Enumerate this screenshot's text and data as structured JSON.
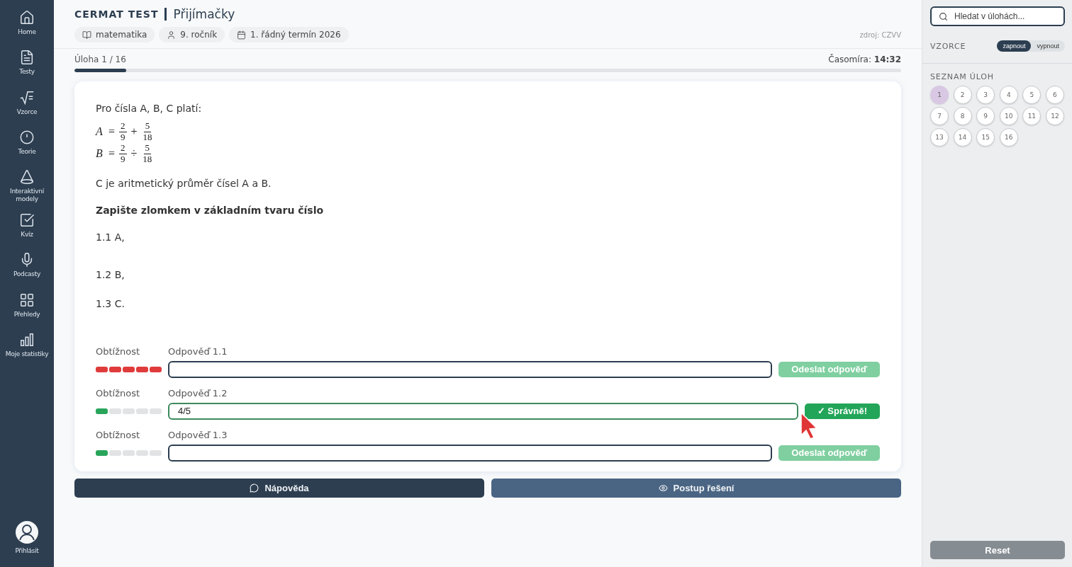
{
  "nav": [
    {
      "label": "Home"
    },
    {
      "label": "Testy"
    },
    {
      "label": "Vzorce"
    },
    {
      "label": "Teorie"
    },
    {
      "label": "Interaktivní modely"
    },
    {
      "label": "Kvíz"
    },
    {
      "label": "Podcasty"
    },
    {
      "label": "Přehledy"
    },
    {
      "label": "Moje statistiky"
    }
  ],
  "account": {
    "label": "Přihlásit"
  },
  "header": {
    "brand": "CERMAT TEST",
    "title": "Přijímačky",
    "chips": [
      {
        "kind": "subject",
        "label": "matematika"
      },
      {
        "kind": "grade",
        "label": "9. ročník"
      },
      {
        "kind": "term",
        "label": "1. řádný termín 2026"
      }
    ],
    "source": "zdroj: CZVV"
  },
  "progress": {
    "label": "Úloha 1 / 16",
    "level": 0.0625,
    "timer_label": "Časomíra:",
    "timer_value": "14:32"
  },
  "task": {
    "intro": "Pro čísla A, B, C platí:",
    "formulas": [
      {
        "variable": "A",
        "relation": "=",
        "left": {
          "num": "2",
          "den": "9"
        },
        "operator": "+",
        "right": {
          "num": "5",
          "den": "18"
        }
      },
      {
        "variable": "B",
        "relation": "=",
        "left": {
          "num": "2",
          "den": "9"
        },
        "operator": "÷",
        "right": {
          "num": "5",
          "den": "18"
        }
      }
    ],
    "statement": "C je aritmetický průměr čísel A a B.",
    "instruction": "Zapište zlomkem v základním tvaru číslo",
    "parts": [
      "1.1 A,",
      "1.2 B,",
      "1.3 C."
    ]
  },
  "answers": [
    {
      "difficulty_label": "Obtížnost",
      "stars": 5,
      "color": "#e03b3b",
      "label": "Odpověď 1.1",
      "correct": false,
      "button": "Odeslat odpověď"
    },
    {
      "difficulty_label": "Obtížnost",
      "stars": 1,
      "color": "#28a55b",
      "label": "Odpověď 1.2",
      "value": "4/5",
      "correct": true,
      "button": "✓ Správně!"
    },
    {
      "difficulty_label": "Obtížnost",
      "stars": 1,
      "color": "#28a55b",
      "label": "Odpověď 1.3",
      "correct": false,
      "button": "Odeslat odpověď"
    }
  ],
  "actions": [
    {
      "kind": "hint",
      "label": "Nápověda"
    },
    {
      "kind": "solution",
      "label": "Postup řešení"
    }
  ],
  "panel": {
    "search": {
      "placeholder": "Hledat v úlohách..."
    },
    "formulas": {
      "title": "VZORCE",
      "options": [
        {
          "label": "zapnout",
          "selected": true
        },
        {
          "label": "vypnout",
          "selected": false
        }
      ]
    },
    "task_list": {
      "title": "SEZNAM ÚLOH",
      "items": [
        {
          "label": "1",
          "selected": true
        },
        {
          "label": "2",
          "selected": false
        },
        {
          "label": "3",
          "selected": false
        },
        {
          "label": "4",
          "selected": false
        },
        {
          "label": "5",
          "selected": false
        },
        {
          "label": "6",
          "selected": false
        },
        {
          "label": "7",
          "selected": false
        },
        {
          "label": "8",
          "selected": false
        },
        {
          "label": "9",
          "selected": false
        },
        {
          "label": "10",
          "selected": false
        },
        {
          "label": "11",
          "selected": false
        },
        {
          "label": "12",
          "selected": false
        },
        {
          "label": "13",
          "selected": false
        },
        {
          "label": "14",
          "selected": false
        },
        {
          "label": "15",
          "selected": false
        },
        {
          "label": "16",
          "selected": false
        }
      ]
    },
    "reset": "Reset"
  }
}
